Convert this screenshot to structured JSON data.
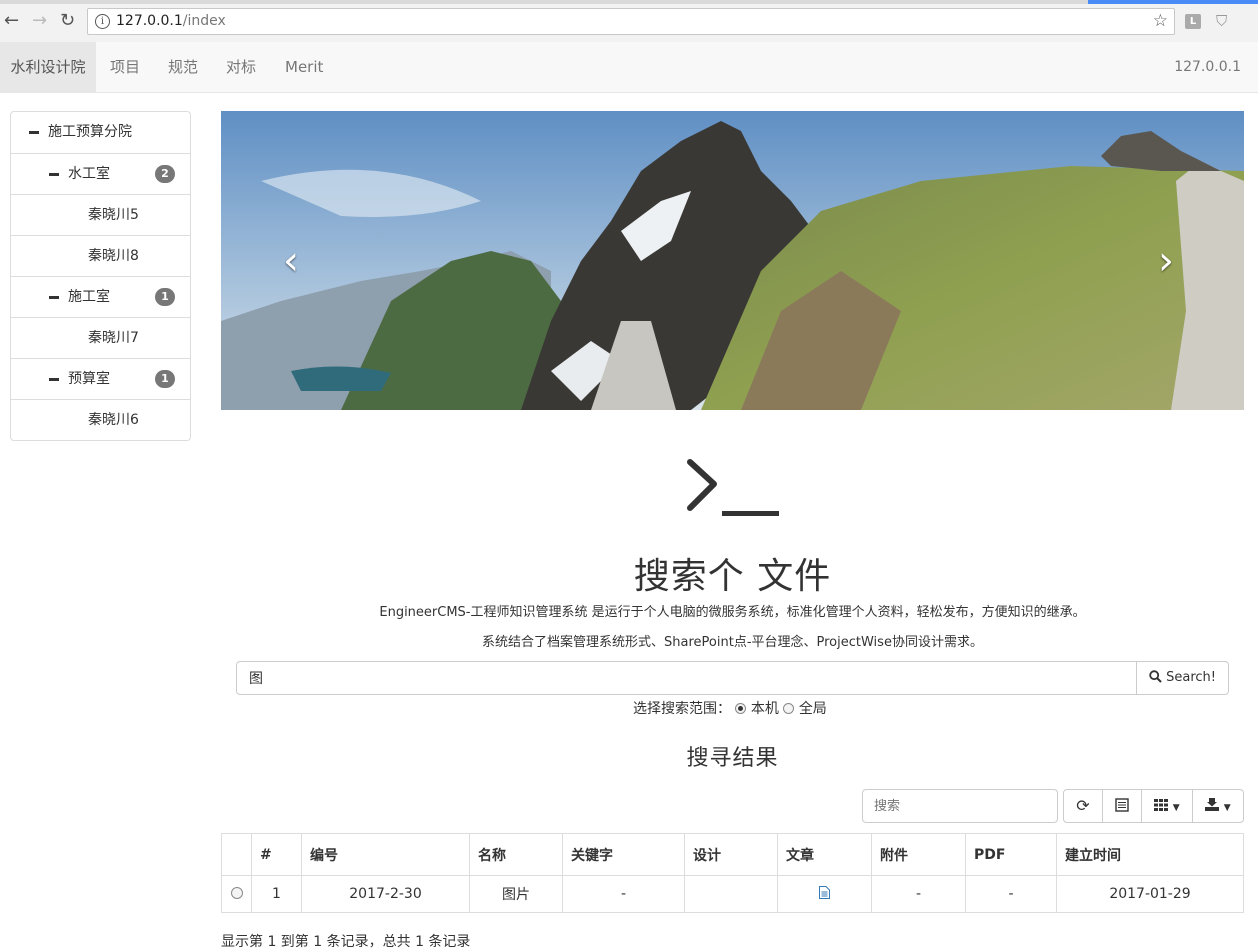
{
  "browser": {
    "url_host": "127.0.0.1",
    "url_path": "/index",
    "ext_label": "L"
  },
  "navbar": {
    "brand": "水利设计院",
    "links": [
      "项目",
      "规范",
      "对标",
      "Merit"
    ],
    "right_text": "127.0.0.1"
  },
  "tree": {
    "root": "施工预算分院",
    "groups": [
      {
        "label": "水工室",
        "count": "2",
        "children": [
          "秦晓川5",
          "秦晓川8"
        ]
      },
      {
        "label": "施工室",
        "count": "1",
        "children": [
          "秦晓川7"
        ]
      },
      {
        "label": "预算室",
        "count": "1",
        "children": [
          "秦晓川6"
        ]
      }
    ]
  },
  "hero": {
    "title": "搜索个 文件",
    "desc1": "EngineerCMS-工程师知识管理系统 是运行于个人电脑的微服务系统，标准化管理个人资料，轻松发布，方便知识的继承。",
    "desc2": "系统结合了档案管理系统形式、SharePoint点-平台理念、ProjectWise协同设计需求。"
  },
  "search": {
    "value": "图",
    "button_label": "Search!",
    "scope_label": "选择搜索范围：",
    "scope_local": "本机",
    "scope_global": "全局"
  },
  "results": {
    "title": "搜寻结果",
    "search_placeholder": "搜索",
    "columns": [
      "#",
      "编号",
      "名称",
      "关键字",
      "设计",
      "文章",
      "附件",
      "PDF",
      "建立时间"
    ],
    "rows": [
      {
        "index": "1",
        "code": "2017-2-30",
        "name": "图片",
        "keywords": "-",
        "design": "",
        "article_icon": "file-text-icon",
        "attachment": "-",
        "pdf": "-",
        "created": "2017-01-29"
      }
    ],
    "footer": "显示第 1 到第 1 条记录，总共 1 条记录"
  }
}
